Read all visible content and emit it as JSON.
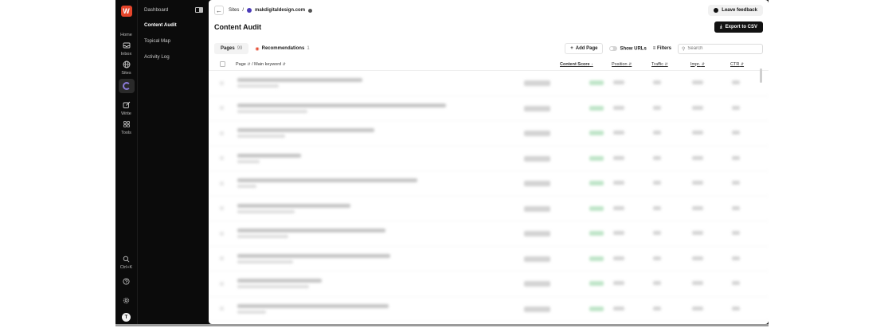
{
  "rail": {
    "logo": "W",
    "items": [
      {
        "label": "Home",
        "icon": "home-icon"
      },
      {
        "label": "Inbox",
        "icon": "inbox-icon"
      },
      {
        "label": "Sites",
        "icon": "globe-icon"
      },
      {
        "label": "Write",
        "icon": "write-icon"
      },
      {
        "label": "Tools",
        "icon": "grid-icon"
      }
    ],
    "search_shortcut": "Ctrl+K",
    "avatar_initial": "T"
  },
  "nav": {
    "items": [
      {
        "label": "Dashboard"
      },
      {
        "label": "Content Audit",
        "active": true
      },
      {
        "label": "Topical Map"
      },
      {
        "label": "Activity Log"
      }
    ]
  },
  "breadcrumb": {
    "root": "Sites",
    "separator": "/",
    "site": "makdigitaldesign.com"
  },
  "header": {
    "feedback_label": "Leave feedback",
    "title": "Content Audit",
    "export_label": "Export to CSV"
  },
  "tabs": [
    {
      "label": "Pages",
      "count": "99"
    },
    {
      "label": "Recommendations",
      "count": "1"
    }
  ],
  "toolbar": {
    "add_page_label": "Add Page",
    "show_urls_label": "Show URLs",
    "filters_label": "Filters",
    "search_placeholder": "Search"
  },
  "table": {
    "columns": {
      "page": "Page",
      "keyword": "/ Main keyword",
      "content_score": "Content Score",
      "position": "Position",
      "traffic": "Traffic",
      "impr": "Impr.",
      "ctr": "CTR"
    },
    "row_count_visible": 10
  },
  "colors": {
    "brand": "#e5452b",
    "sidebar_bg": "#0b0b0b",
    "accent_purple": "#8b7bd8",
    "score_green": "#bfe5c8"
  }
}
